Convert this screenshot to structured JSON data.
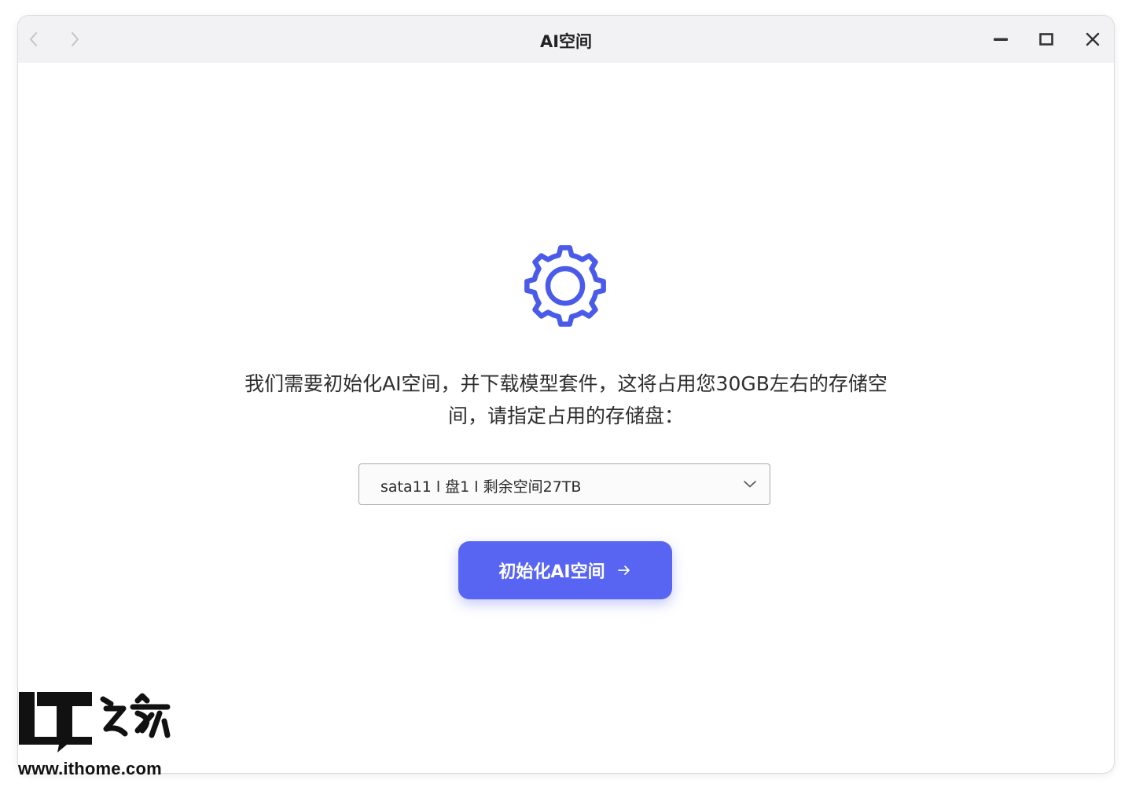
{
  "window": {
    "title": "AI空间"
  },
  "titlebar": {
    "back_icon": "chevron-left-icon",
    "forward_icon": "chevron-right-icon",
    "minimize_icon": "minimize-icon",
    "maximize_icon": "maximize-icon",
    "close_icon": "close-icon"
  },
  "main": {
    "icon": "gear-icon",
    "icon_color": "#4a5bea",
    "message": "我们需要初始化AI空间，并下载模型套件，这将占用您30GB左右的存储空间，请指定占用的存储盘：",
    "storage_select": {
      "value": "sata11 l 盘1 l 剩余空间27TB",
      "chevron_icon": "chevron-down-icon"
    },
    "init_button": {
      "label": "初始化AI空间",
      "icon": "arrow-right-icon",
      "color": "#5865f2"
    }
  },
  "watermark": {
    "logo_text": "IT之家",
    "url": "www.ithome.com"
  }
}
